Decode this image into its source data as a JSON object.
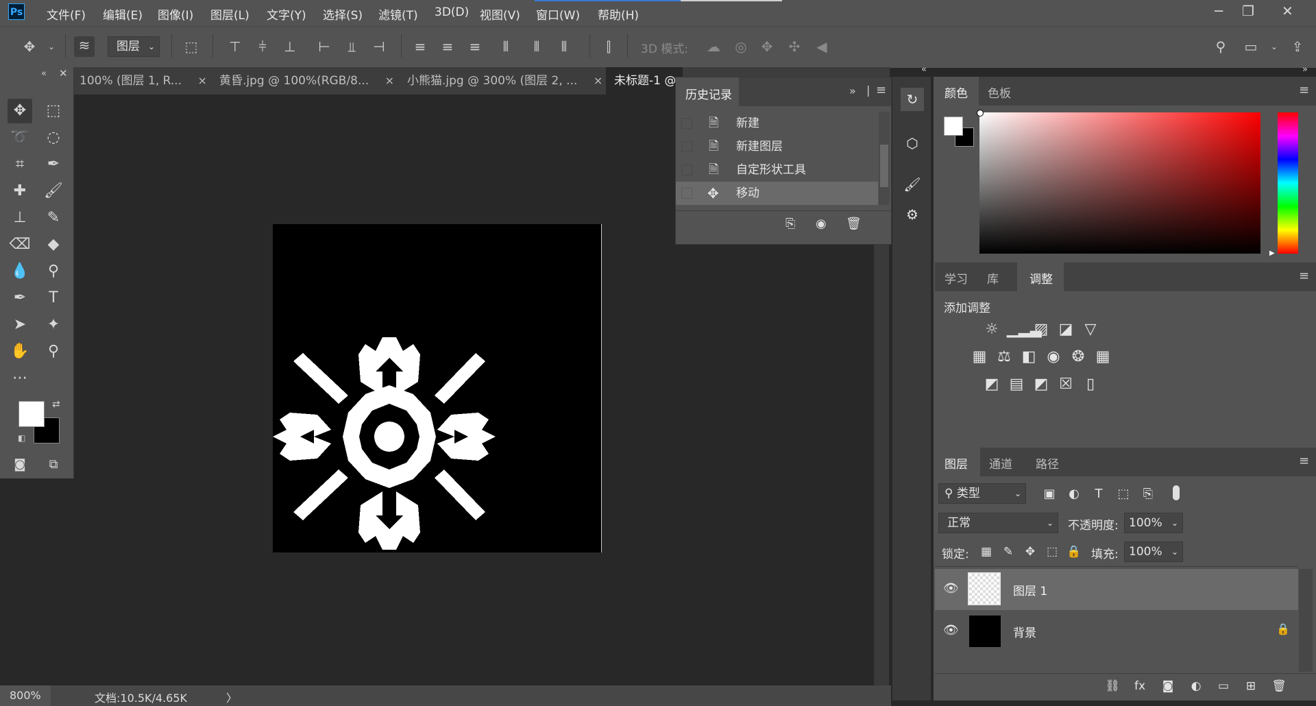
{
  "app": {
    "logo": "Ps"
  },
  "menu": [
    "文件(F)",
    "编辑(E)",
    "图像(I)",
    "图层(L)",
    "文字(Y)",
    "选择(S)",
    "滤镜(T)",
    "3D(D)",
    "视图(V)",
    "窗口(W)",
    "帮助(H)"
  ],
  "window_controls": {
    "minimize": "─",
    "restore": "❐",
    "close": "✕"
  },
  "options_bar": {
    "auto_select_target": "图层",
    "mode_3d_label": "3D 模式:"
  },
  "tabs": [
    {
      "label": "100% (图层 1, R...",
      "close": "×"
    },
    {
      "label": "黄昏.jpg @ 100%(RGB/8...",
      "close": "×"
    },
    {
      "label": "小熊猫.jpg @ 300% (图层 2, ...",
      "close": "×"
    },
    {
      "label": "未标题-1 @",
      "close": ""
    }
  ],
  "history": {
    "title": "历史记录",
    "items": [
      {
        "label": "新建",
        "icon": "doc-icon"
      },
      {
        "label": "新建图层",
        "icon": "doc-icon"
      },
      {
        "label": "自定形状工具",
        "icon": "doc-icon"
      },
      {
        "label": "移动",
        "icon": "move-icon",
        "selected": true
      }
    ]
  },
  "color_panel": {
    "tabs": [
      "颜色",
      "色板"
    ],
    "active": "颜色"
  },
  "adjust_panel": {
    "tabs": [
      "学习",
      "库",
      "调整"
    ],
    "active": "调整",
    "heading": "添加调整"
  },
  "layers_panel": {
    "tabs": [
      "图层",
      "通道",
      "路径"
    ],
    "active": "图层",
    "filter_label": "类型",
    "blend_mode": "正常",
    "opacity_label": "不透明度:",
    "opacity_value": "100%",
    "lock_label": "锁定:",
    "fill_label": "填充:",
    "fill_value": "100%",
    "layers": [
      {
        "name": "图层 1",
        "selected": true
      },
      {
        "name": "背景",
        "locked": true
      }
    ]
  },
  "status": {
    "zoom": "800%",
    "doc_info": "文档:10.5K/4.65K",
    "arrow": "〉"
  },
  "colors": {
    "ui_bg": "#535353",
    "canvas_bg": "#282828",
    "foreground": "#ffffff",
    "background": "#000000"
  }
}
